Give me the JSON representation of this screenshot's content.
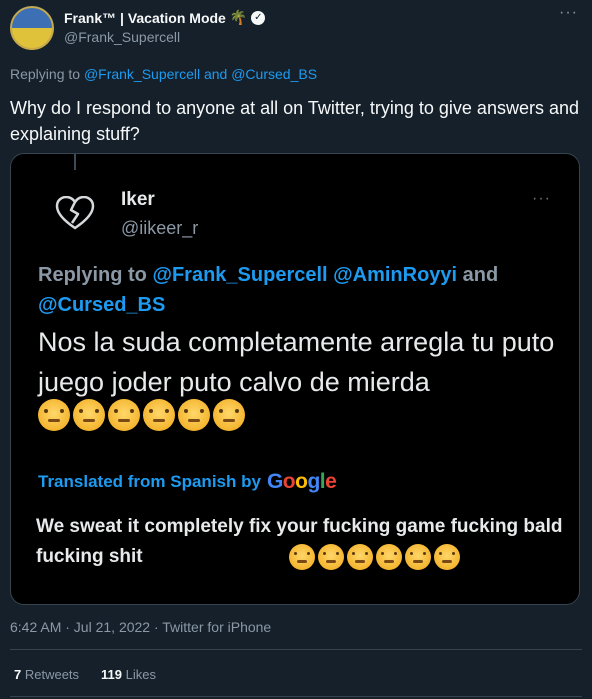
{
  "author": {
    "display_name": "Frank™ | Vacation Mode",
    "emoji": "🌴",
    "verified_icon": "verified-badge-icon",
    "handle": "@Frank_Supercell"
  },
  "reply_context": {
    "prefix": "Replying to ",
    "mentions": "@Frank_Supercell and @Cursed_BS"
  },
  "tweet_text": "Why do I respond to anyone at all on Twitter, trying to give answers and explaining stuff?",
  "embedded_tweet": {
    "author_name": "Iker",
    "author_handle": "@iikeer_r",
    "replying_prefix": "Replying to ",
    "replying_mentions_1": "@Frank_Supercell @AminRoyyi",
    "replying_and": " and ",
    "replying_mentions_2": "@Cursed_BS",
    "original_text": "Nos la suda completamente arregla tu puto juego joder puto calvo de mierda",
    "translated_label": "Translated from Spanish by",
    "translation_provider": "Google",
    "translated_text": "We sweat it completely fix your fucking game fucking bald fucking shit"
  },
  "timestamp": "6:42 AM · Jul 21, 2022 · Twitter for iPhone",
  "stats": {
    "retweets_count": "7",
    "retweets_label": " Retweets",
    "likes_count": "119",
    "likes_label": " Likes"
  },
  "colors": {
    "background": "#15202b",
    "link": "#1d9bf0",
    "muted": "#8b98a5"
  }
}
